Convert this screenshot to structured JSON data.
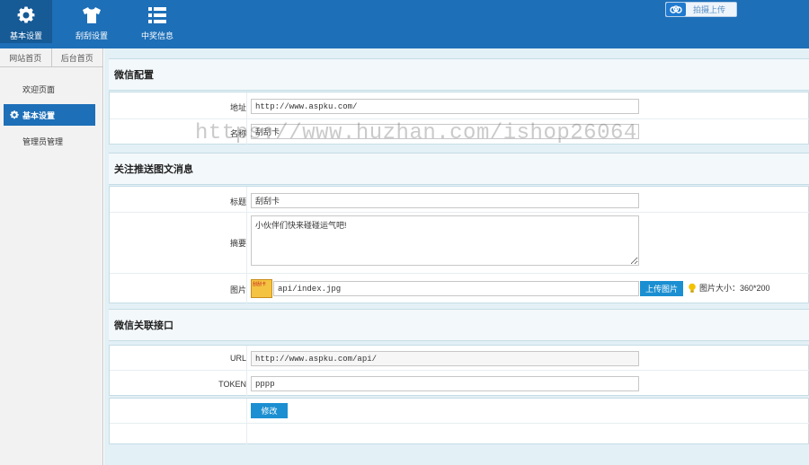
{
  "topbar": {
    "nav": [
      {
        "label": "基本设置",
        "icon": "gear-icon"
      },
      {
        "label": "刮刮设置",
        "icon": "tshirt-icon"
      },
      {
        "label": "中奖信息",
        "icon": "list-icon"
      }
    ],
    "upload_label": "拍摄上传",
    "upload_icon": "cloud-icon"
  },
  "sidebar": {
    "tabs": [
      "网站首页",
      "后台首页"
    ],
    "items": [
      {
        "label": "欢迎页面",
        "active": false
      },
      {
        "label": "基本设置",
        "active": true
      },
      {
        "label": "管理员管理",
        "active": false
      }
    ]
  },
  "wechat_config": {
    "title": "微信配置",
    "address_label": "地址",
    "address_value": "http://www.aspku.com/",
    "name_label": "名称",
    "name_value": "刮刮卡"
  },
  "follow_push": {
    "title": "关注推送图文消息",
    "title_label": "标题",
    "title_value": "刮刮卡",
    "summary_label": "摘要",
    "summary_value": "小伙伴们快来碰碰运气吧!",
    "image_label": "图片",
    "image_value": "api/index.jpg",
    "upload_button": "上传图片",
    "size_hint": "图片大小：360*200",
    "thumb_text": "刮刮卡"
  },
  "wechat_api": {
    "title": "微信关联接口",
    "url_label": "URL",
    "url_value": "http://www.aspku.com/api/",
    "token_label": "TOKEN",
    "token_value": "pppp",
    "submit_button": "修改"
  },
  "watermark": "https://www.huzhan.com/ishop26064",
  "colors": {
    "topbar": "#1d6fb8",
    "accent_button": "#1b8fd1",
    "content_bg": "#e3f0f5"
  }
}
